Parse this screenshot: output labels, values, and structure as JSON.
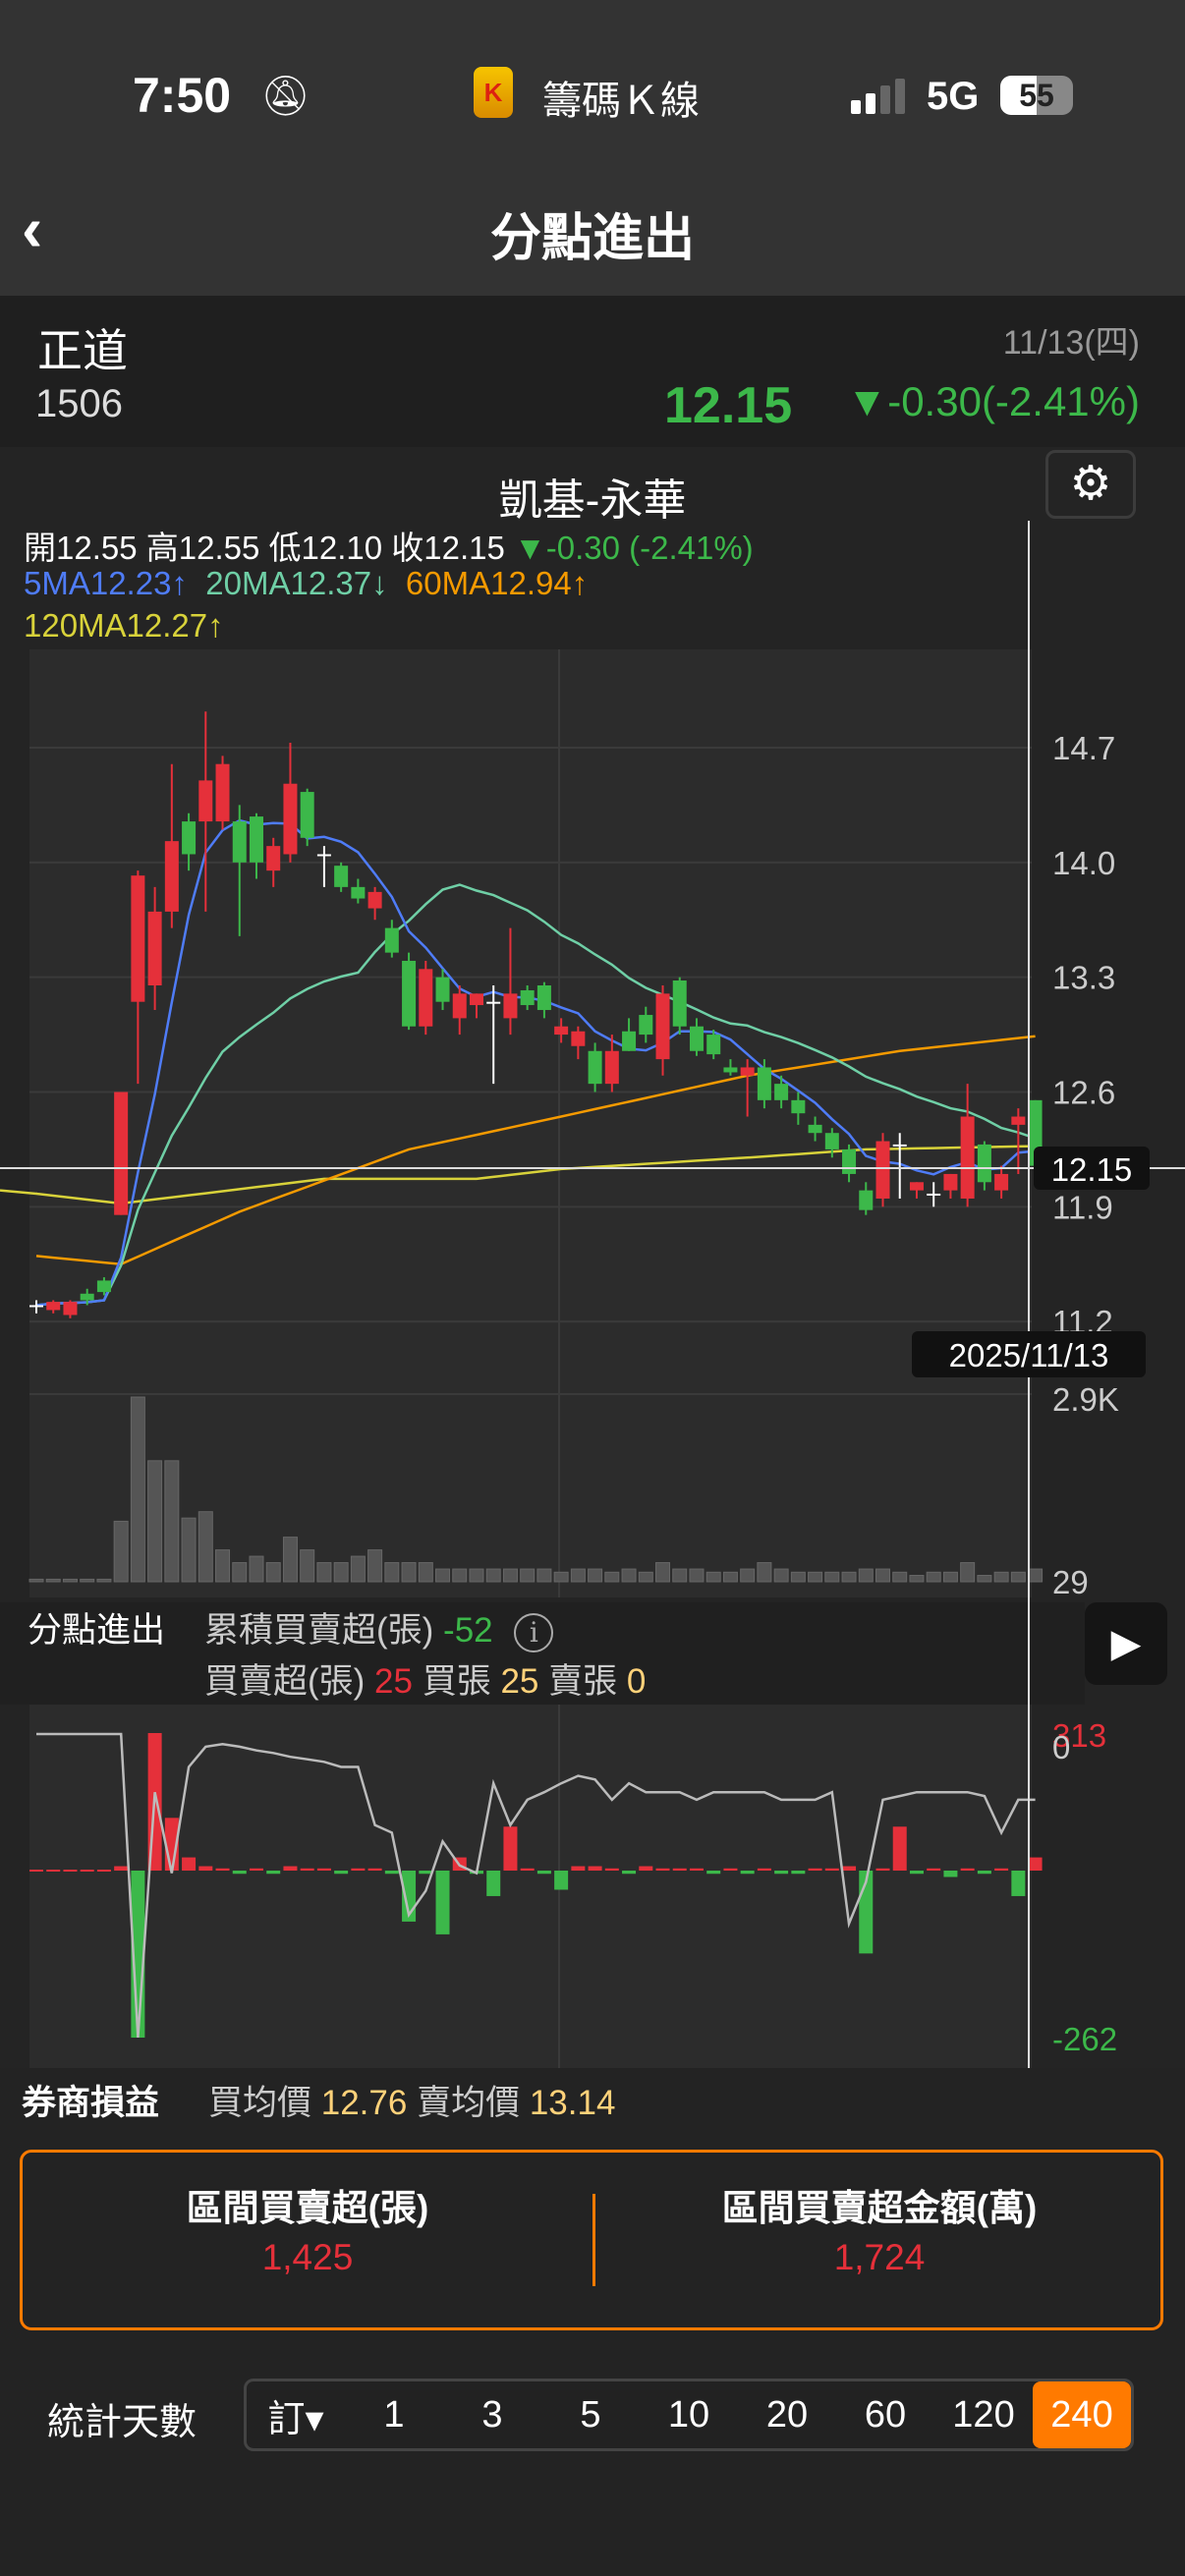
{
  "status": {
    "time": "7:50",
    "app": "籌碼Ｋ線",
    "network": "5G",
    "battery": "55"
  },
  "nav": {
    "title": "分點進出"
  },
  "stock": {
    "name": "正道",
    "code": "1506",
    "date": "11/13(四)",
    "price": "12.15",
    "change": "▼-0.30(-2.41%)"
  },
  "chart": {
    "broker": "凱基-永華",
    "ohlc": {
      "open_label": "開",
      "open": "12.55",
      "high_label": "高",
      "high": "12.55",
      "low_label": "低",
      "low": "12.10",
      "close_label": "收",
      "close": "12.15",
      "change": "▼-0.30 (-2.41%)"
    },
    "ma": {
      "ma5": "5MA12.23↑",
      "ma20": "20MA12.37↓",
      "ma60": "60MA12.94↑",
      "ma120": "120MA12.27↑"
    },
    "crosshair_price": "12.15",
    "crosshair_date": "2025/11/13",
    "vol_labels": {
      "max": "2.9K",
      "min": "29"
    }
  },
  "colors": {
    "up": "#e5303a",
    "down": "#3cb84a",
    "ma5": "#4f7cf7",
    "ma20": "#6fcfa6",
    "ma60": "#f59a00",
    "ma120": "#d8d23a",
    "accent": "#ff7a00"
  },
  "chart_data": {
    "type": "candlestick",
    "price_ticks": [
      "14.7",
      "14.0",
      "13.3",
      "12.6",
      "11.9",
      "11.2"
    ],
    "price_tick_values": [
      14.7,
      14.0,
      13.3,
      12.6,
      11.9,
      11.2
    ],
    "ylim": [
      11.2,
      14.7
    ],
    "candles": [
      [
        11.3,
        11.33,
        11.25,
        11.3
      ],
      [
        11.27,
        11.33,
        11.25,
        11.32
      ],
      [
        11.24,
        11.33,
        11.22,
        11.32
      ],
      [
        11.37,
        11.4,
        11.3,
        11.33
      ],
      [
        11.45,
        11.47,
        11.36,
        11.38
      ],
      [
        11.85,
        12.6,
        11.85,
        12.6
      ],
      [
        13.15,
        13.95,
        12.65,
        13.92
      ],
      [
        13.25,
        13.85,
        13.1,
        13.7
      ],
      [
        13.7,
        14.6,
        13.6,
        14.13
      ],
      [
        14.25,
        14.3,
        13.95,
        14.05
      ],
      [
        14.25,
        14.92,
        13.7,
        14.5
      ],
      [
        14.25,
        14.65,
        14.2,
        14.6
      ],
      [
        14.25,
        14.35,
        13.55,
        14.0
      ],
      [
        14.28,
        14.3,
        13.9,
        14.0
      ],
      [
        13.95,
        14.15,
        13.85,
        14.1
      ],
      [
        14.05,
        14.73,
        14.0,
        14.48
      ],
      [
        14.43,
        14.45,
        14.1,
        14.15
      ],
      [
        14.05,
        14.1,
        13.85,
        14.05
      ],
      [
        13.98,
        14.0,
        13.82,
        13.85
      ],
      [
        13.85,
        13.9,
        13.75,
        13.78
      ],
      [
        13.72,
        13.85,
        13.65,
        13.82
      ],
      [
        13.6,
        13.65,
        13.42,
        13.45
      ],
      [
        13.4,
        13.45,
        12.98,
        13.0
      ],
      [
        13.0,
        13.4,
        12.95,
        13.35
      ],
      [
        13.3,
        13.35,
        13.1,
        13.15
      ],
      [
        13.05,
        13.25,
        12.95,
        13.2
      ],
      [
        13.13,
        13.2,
        13.05,
        13.2
      ],
      [
        13.15,
        13.25,
        12.65,
        13.15
      ],
      [
        13.05,
        13.6,
        12.95,
        13.2
      ],
      [
        13.22,
        13.25,
        13.1,
        13.13
      ],
      [
        13.25,
        13.27,
        13.05,
        13.1
      ],
      [
        12.95,
        13.05,
        12.9,
        13.0
      ],
      [
        12.88,
        13.0,
        12.8,
        12.97
      ],
      [
        12.85,
        12.9,
        12.6,
        12.65
      ],
      [
        12.65,
        12.95,
        12.6,
        12.85
      ],
      [
        12.97,
        13.05,
        12.85,
        12.85
      ],
      [
        13.07,
        13.12,
        12.9,
        12.95
      ],
      [
        12.8,
        13.25,
        12.7,
        13.2
      ],
      [
        13.28,
        13.3,
        12.95,
        13.0
      ],
      [
        13.0,
        13.05,
        12.82,
        12.85
      ],
      [
        12.95,
        12.98,
        12.8,
        12.83
      ],
      [
        12.75,
        12.8,
        12.7,
        12.72
      ],
      [
        12.7,
        12.8,
        12.45,
        12.75
      ],
      [
        12.75,
        12.8,
        12.5,
        12.55
      ],
      [
        12.65,
        12.7,
        12.5,
        12.55
      ],
      [
        12.55,
        12.6,
        12.4,
        12.47
      ],
      [
        12.4,
        12.45,
        12.3,
        12.35
      ],
      [
        12.35,
        12.38,
        12.2,
        12.25
      ],
      [
        12.25,
        12.28,
        12.05,
        12.1
      ],
      [
        12.0,
        12.05,
        11.85,
        11.88
      ],
      [
        11.95,
        12.35,
        11.9,
        12.3
      ],
      [
        12.28,
        12.35,
        11.95,
        12.28
      ],
      [
        12.0,
        12.05,
        11.95,
        12.05
      ],
      [
        11.98,
        12.05,
        11.9,
        11.98
      ],
      [
        12.0,
        12.1,
        11.95,
        12.1
      ],
      [
        11.95,
        12.65,
        11.9,
        12.45
      ],
      [
        12.28,
        12.3,
        12.0,
        12.05
      ],
      [
        12.0,
        12.15,
        11.95,
        12.1
      ],
      [
        12.4,
        12.5,
        12.1,
        12.45
      ],
      [
        12.55,
        12.55,
        12.1,
        12.15
      ]
    ],
    "ma60_points": [
      [
        0,
        11.6
      ],
      [
        5,
        11.55
      ],
      [
        12,
        11.87
      ],
      [
        22,
        12.25
      ],
      [
        31,
        12.45
      ],
      [
        42,
        12.7
      ],
      [
        51,
        12.85
      ],
      [
        59,
        12.94
      ]
    ],
    "ma120_points": [
      [
        0,
        11.98
      ],
      [
        5,
        11.92
      ],
      [
        17,
        12.07
      ],
      [
        26,
        12.07
      ],
      [
        31,
        12.13
      ],
      [
        42,
        12.2
      ],
      [
        49,
        12.25
      ],
      [
        59,
        12.27
      ]
    ],
    "volume": [
      40,
      40,
      40,
      40,
      40,
      950,
      2900,
      1900,
      1900,
      1000,
      1100,
      500,
      300,
      400,
      300,
      700,
      500,
      300,
      300,
      400,
      500,
      300,
      300,
      300,
      200,
      200,
      200,
      200,
      200,
      200,
      200,
      150,
      200,
      200,
      150,
      200,
      150,
      300,
      200,
      200,
      150,
      150,
      200,
      300,
      200,
      150,
      150,
      150,
      150,
      200,
      200,
      150,
      100,
      150,
      150,
      300,
      100,
      150,
      150,
      200
    ],
    "net": [
      0,
      0,
      0,
      0,
      0,
      10,
      -262,
      313,
      120,
      30,
      10,
      5,
      -5,
      5,
      -5,
      10,
      5,
      5,
      -5,
      5,
      5,
      -5,
      -80,
      -5,
      -100,
      30,
      -5,
      -40,
      100,
      5,
      -5,
      -30,
      10,
      10,
      5,
      -5,
      10,
      5,
      5,
      5,
      -5,
      5,
      -5,
      5,
      -5,
      -5,
      5,
      5,
      10,
      -130,
      5,
      100,
      -5,
      5,
      -10,
      5,
      -5,
      5,
      -40,
      30
    ],
    "cumulative": [
      0,
      0,
      0,
      0,
      0,
      0,
      -240,
      -46,
      -110,
      -26,
      -10,
      -8,
      -10,
      -13,
      -15,
      -18,
      -20,
      -22,
      -26,
      -26,
      -72,
      -78,
      -143,
      -124,
      -85,
      -104,
      -110,
      -39,
      -72,
      -52,
      -46,
      -39,
      -33,
      -36,
      -52,
      -39,
      -46,
      -46,
      -46,
      -52,
      -46,
      -46,
      -46,
      -46,
      -52,
      -52,
      -52,
      -46,
      -150,
      -117,
      -52,
      -49,
      -46,
      -46,
      -46,
      -46,
      -49,
      -78,
      -52,
      -52
    ],
    "net_labels": {
      "max": "313",
      "zero": "0",
      "min": "-262"
    }
  },
  "flow": {
    "title": "分點進出",
    "cum_label": "累積買賣超(張)",
    "cum_value": "-52",
    "net_label": "買賣超(張)",
    "net_value": "25",
    "buy_label": "買張",
    "buy_value": "25",
    "sell_label": "賣張",
    "sell_value": "0"
  },
  "pnl": {
    "title": "券商損益",
    "buy_avg_label": "買均價",
    "buy_avg": "12.76",
    "sell_avg_label": "賣均價",
    "sell_avg": "13.14"
  },
  "summary": {
    "net_lots_label": "區間買賣超(張)",
    "net_lots": "1,425",
    "net_amount_label": "區間買賣超金額(萬)",
    "net_amount": "1,724"
  },
  "days": {
    "label": "統計天數",
    "options": [
      "訂▾",
      "1",
      "3",
      "5",
      "10",
      "20",
      "60",
      "120",
      "240"
    ],
    "selected": "240"
  }
}
